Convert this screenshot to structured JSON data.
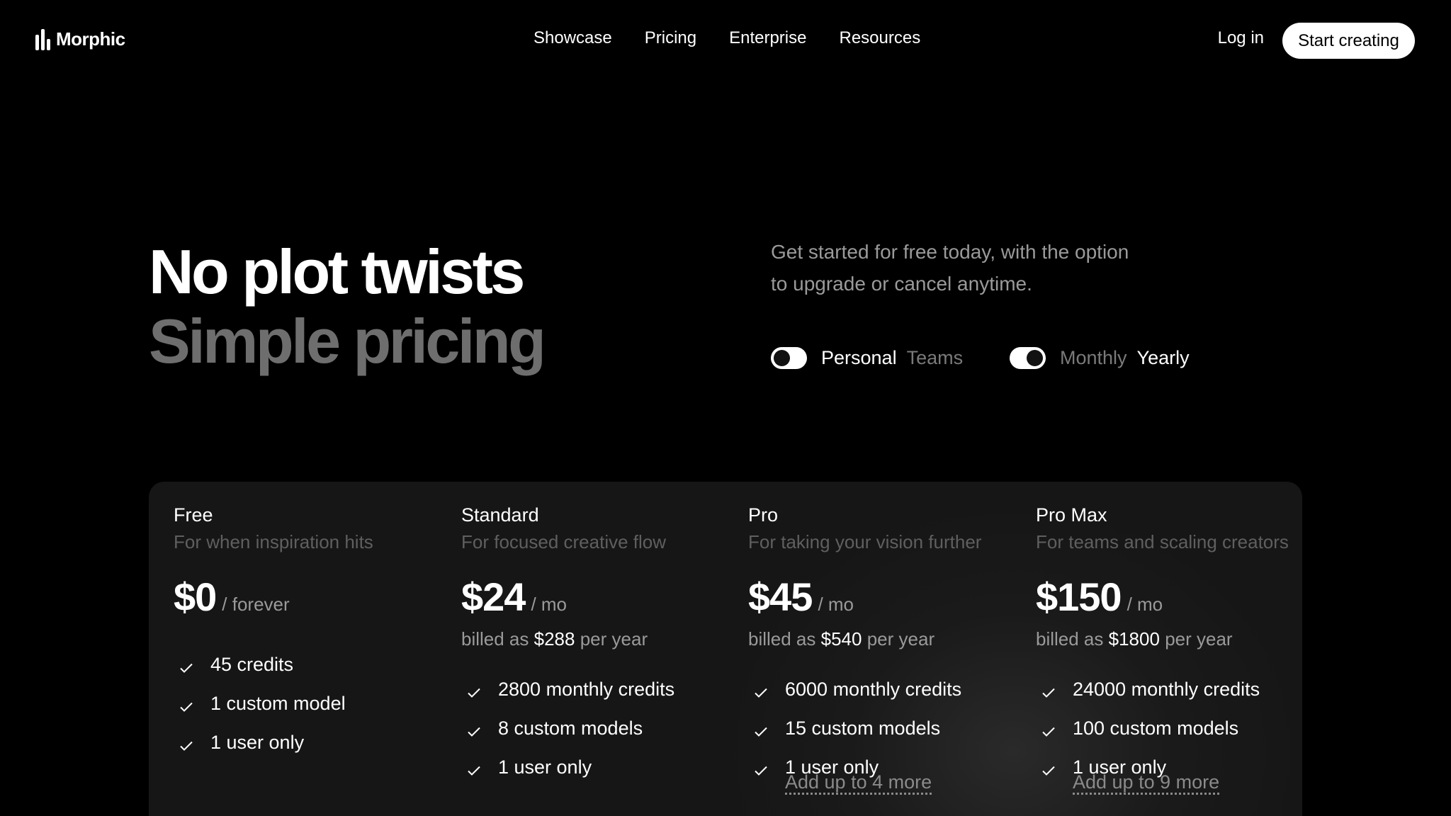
{
  "nav": {
    "logo_text": "Morphic",
    "links": [
      "Showcase",
      "Pricing",
      "Enterprise",
      "Resources"
    ],
    "login": "Log in",
    "cta": "Start creating"
  },
  "hero": {
    "title_line1": "No plot twists",
    "title_line2": "Simple pricing",
    "subtitle_line1": "Get started for free today, with the option",
    "subtitle_line2": "to upgrade or cancel anytime."
  },
  "toggles": {
    "audience": {
      "selected": "Personal",
      "other": "Teams"
    },
    "billing": {
      "other": "Monthly",
      "selected": "Yearly"
    }
  },
  "plans": [
    {
      "name": "Free",
      "tagline": "For when inspiration hits",
      "price": "$0",
      "period": "/ forever",
      "billed_prefix": "",
      "billed_amount": "",
      "billed_suffix": "",
      "features": [
        "45 credits",
        "1 custom model",
        "1 user only"
      ],
      "add_more": ""
    },
    {
      "name": "Standard",
      "tagline": "For focused creative flow",
      "price": "$24",
      "period": "/ mo",
      "billed_prefix": "billed as",
      "billed_amount": "$288",
      "billed_suffix": "per year",
      "features": [
        "2800 monthly credits",
        "8 custom models",
        "1 user only"
      ],
      "add_more": ""
    },
    {
      "name": "Pro",
      "tagline": "For taking your vision further",
      "price": "$45",
      "period": "/ mo",
      "billed_prefix": "billed as",
      "billed_amount": "$540",
      "billed_suffix": "per year",
      "features": [
        "6000 monthly credits",
        "15 custom models",
        "1 user only"
      ],
      "add_more": "Add up to 4 more"
    },
    {
      "name": "Pro Max",
      "tagline": "For teams and scaling creators",
      "price": "$150",
      "period": "/ mo",
      "billed_prefix": "billed as",
      "billed_amount": "$1800",
      "billed_suffix": "per year",
      "features": [
        "24000 monthly credits",
        "100 custom models",
        "1 user only"
      ],
      "add_more": "Add up to 9 more"
    }
  ],
  "colors": {
    "background": "#000000",
    "panel": "#161616",
    "muted_text": "#9a9a9a",
    "dim_text": "#5f5f5f",
    "title_secondary": "#6e6e6e"
  }
}
